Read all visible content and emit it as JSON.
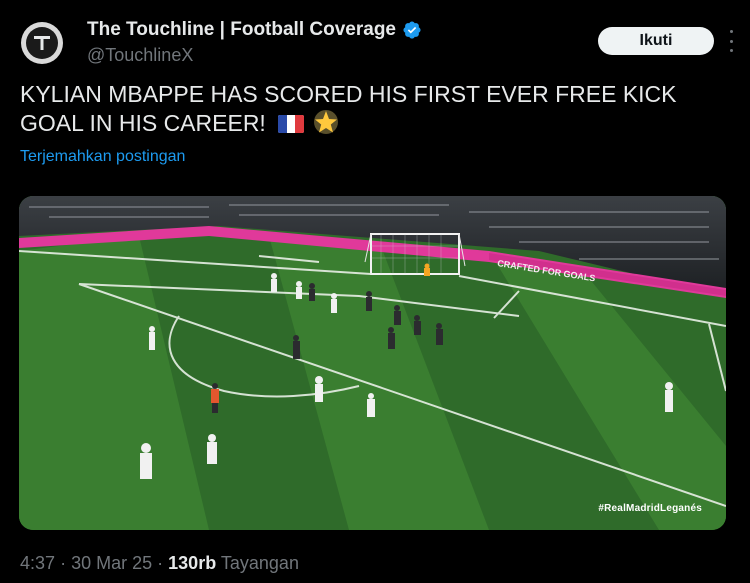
{
  "author": {
    "display_name": "The Touchline | Football Coverage",
    "handle": "@TouchlineX",
    "avatar_letter": "T",
    "verified": true
  },
  "actions": {
    "follow_label": "Ikuti"
  },
  "tweet": {
    "text": "KYLIAN MBAPPE HAS SCORED HIS FIRST EVER FREE KICK GOAL IN HIS CAREER!",
    "emojis": [
      "flag-france",
      "glowing-star"
    ],
    "translate_label": "Terjemahkan postingan"
  },
  "media": {
    "banner_text": "CRAFTED FOR GOALS",
    "hashtag": "#RealMadridLeganés"
  },
  "meta": {
    "time": "4:37",
    "date": "30 Mar 25",
    "views": "130rb",
    "views_label": "Tayangan",
    "separator": "·"
  },
  "colors": {
    "accent": "#1d9bf0",
    "verified": "#1d9bf0",
    "pitch_light": "#3f8a33",
    "pitch_dark": "#2f6b2a",
    "ad_board": "#e0399a"
  }
}
